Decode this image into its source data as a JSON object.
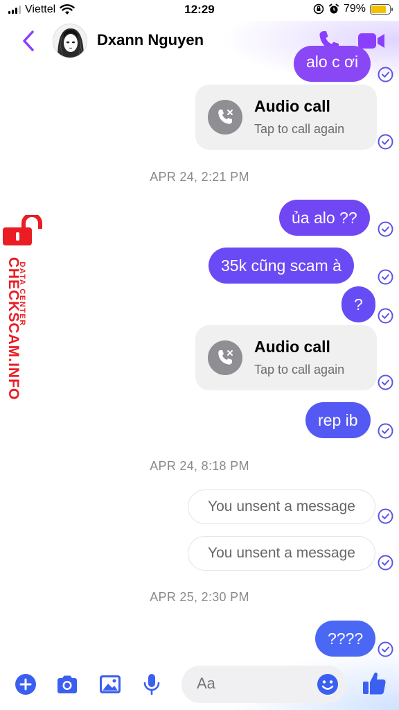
{
  "status_bar": {
    "carrier": "Viettel",
    "time": "12:29",
    "battery": "79%",
    "battery_level": 0.79
  },
  "header": {
    "contact_name": "Dxann Nguyen"
  },
  "messages": {
    "m0": "alo c ơi",
    "d1": "APR 24, 2:21 PM",
    "m1": "ủa alo ??",
    "m2": "35k cũng scam à",
    "m3": "?",
    "m5": "rep ib",
    "d2": "APR 24, 8:18 PM",
    "d3": "APR 25, 2:30 PM",
    "m8": "????"
  },
  "call_cards": [
    {
      "title": "Audio call",
      "subtitle": "Tap to call again"
    },
    {
      "title": "Audio call",
      "subtitle": "Tap to call again"
    }
  ],
  "unsent": [
    {
      "text": "You unsent a message"
    },
    {
      "text": "You unsent a message"
    }
  ],
  "watermark": {
    "main": "CHECKSCAM.INFO",
    "sub": "DATA CENTER"
  },
  "composer": {
    "placeholder": "Aa"
  },
  "colors": {
    "accent": "#8a3ffc",
    "bubble_purple": "#6e49f2",
    "bubble_blue": "#4a68f4",
    "tick": "#5b55e8",
    "watermark": "#ea1c24"
  }
}
